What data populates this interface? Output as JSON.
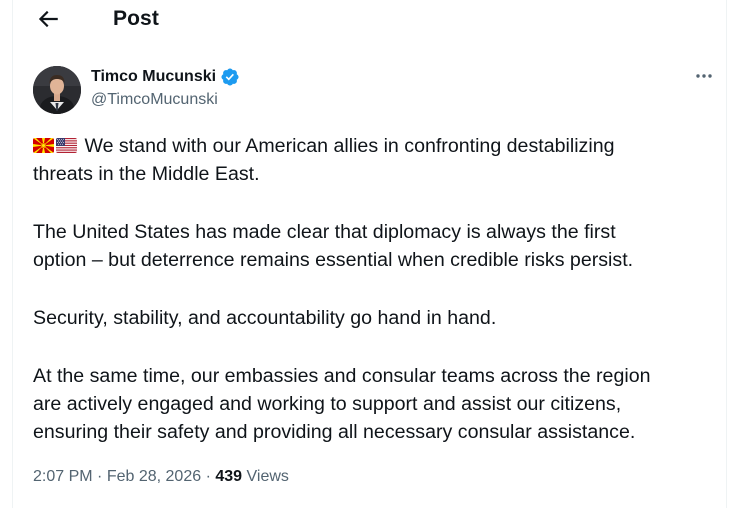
{
  "header": {
    "title": "Post",
    "back_icon": "arrow-left-icon"
  },
  "author": {
    "display_name": "Timco Mucunski",
    "handle": "@TimcoMucunski",
    "verified": true,
    "verified_icon": "verified-badge-icon",
    "avatar": "profile-photo"
  },
  "post": {
    "flags": [
      "north-macedonia-flag-icon",
      "united-states-flag-icon"
    ],
    "paragraphs": [
      {
        "line1": "We stand with our American allies in confronting destabilizing",
        "line2": "threats in the Middle East."
      },
      {
        "line1": "The United States has made clear that diplomacy is always the first",
        "line2": "option – but deterrence remains essential when credible risks persist."
      },
      {
        "line1": "Security, stability, and accountability go hand in hand."
      },
      {
        "line1": "At the same time, our embassies and consular teams across the region",
        "line2": "are actively engaged and working to support and assist our citizens,",
        "line3": "ensuring their safety and providing all necessary consular assistance."
      }
    ]
  },
  "meta": {
    "time": "2:07 PM",
    "separator": "·",
    "date": "Feb 28, 2026",
    "views_count": "439",
    "views_label": "Views"
  },
  "more_icon": "more-horizontal-icon",
  "colors": {
    "text": "#0f1419",
    "secondary": "#536471",
    "verified": "#1d9bf0",
    "divider": "#eff3f4"
  }
}
